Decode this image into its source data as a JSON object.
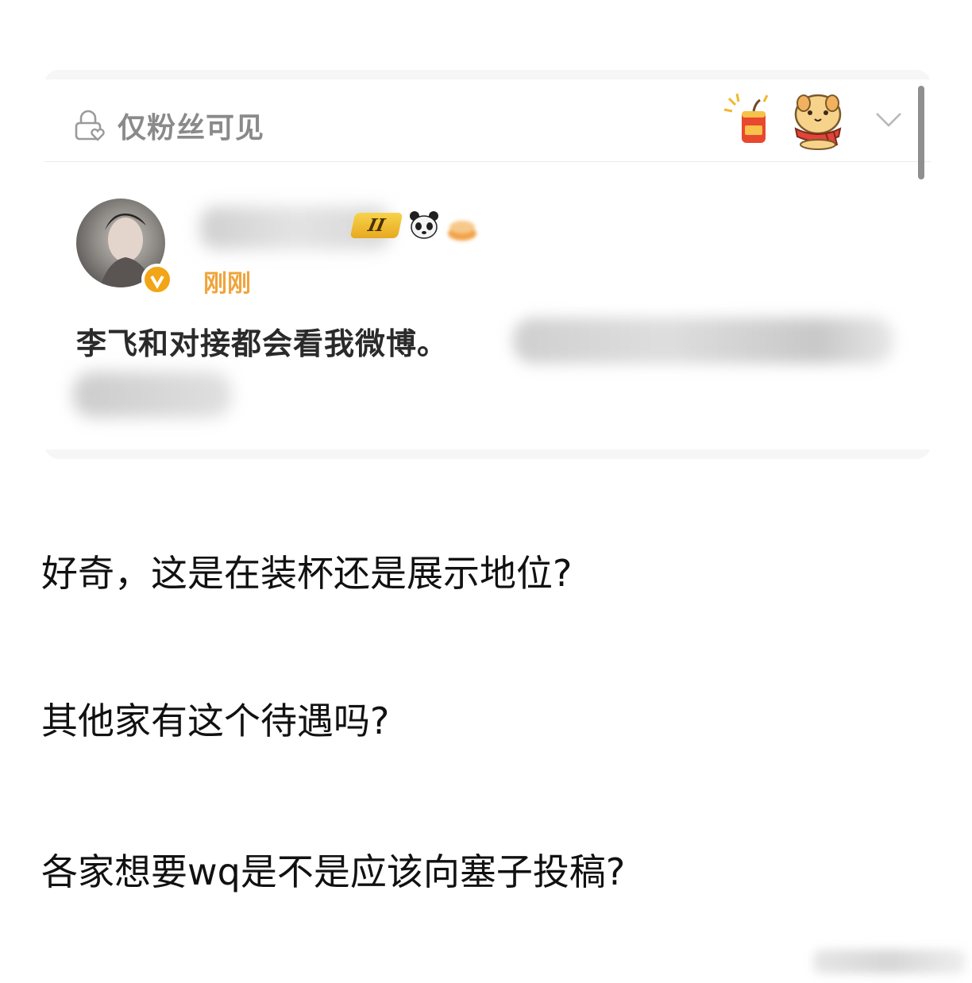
{
  "card": {
    "visibility_label": "仅粉丝可见",
    "post": {
      "level_badge": "II",
      "timestamp": "刚刚",
      "text": "李飞和对接都会看我微博。"
    }
  },
  "questions": [
    "好奇，这是在装杯还是展示地位?",
    "其他家有这个待遇吗?",
    "各家想要wq是不是应该向塞子投稿?"
  ],
  "icons": {
    "visibility": "lock-heart-icon",
    "sticker_1": "firecracker-icon",
    "sticker_2": "dog-scarf-icon",
    "expand": "chevron-down-icon",
    "badge_1": "panda-icon",
    "badge_2": "cake-icon"
  },
  "colors": {
    "timestamp": "#f0a43a",
    "verified": "#f2a516",
    "level_badge": "#e7a921"
  }
}
